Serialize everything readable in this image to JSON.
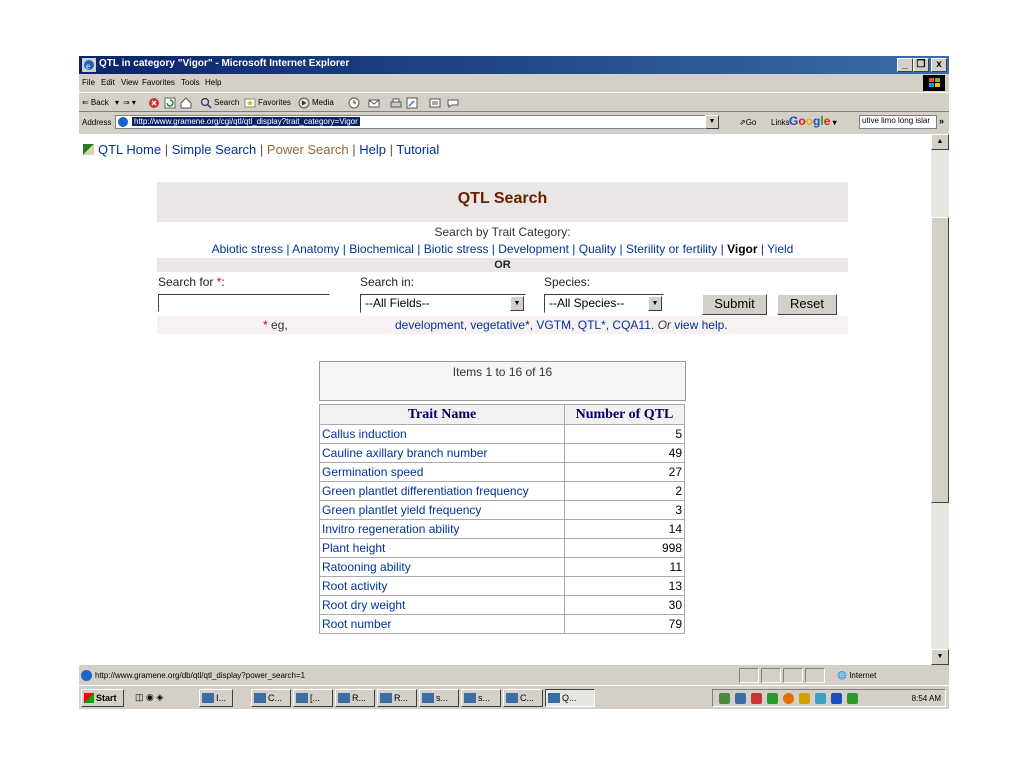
{
  "window": {
    "title": "QTL in category \"Vigor\" - Microsoft Internet Explorer",
    "controls": [
      "_",
      "❐",
      "x"
    ]
  },
  "menu": [
    "File",
    "Edit",
    "View",
    "Favorites",
    "Tools",
    "Help"
  ],
  "toolbar": {
    "back": "⇐ Back",
    "search": "Search",
    "favorites": "Favorites",
    "media": "Media"
  },
  "address": {
    "label": "Address",
    "url": "http://www.gramene.org/cgi/qtl/qtl_display?trait_category=Vigor",
    "go": "Go",
    "links": "Links",
    "google": "Google",
    "search_text": "utive limo long islar"
  },
  "nav": {
    "home": "QTL Home",
    "simple": "Simple Search",
    "power": "Power Search",
    "help": "Help",
    "tutorial": "Tutorial"
  },
  "search": {
    "title": "QTL Search",
    "category_header": "Search by Trait Category:",
    "categories": [
      "Abiotic stress",
      "Anatomy",
      "Biochemical",
      "Biotic stress",
      "Development",
      "Quality",
      "Sterility or fertility",
      "Vigor",
      "Yield"
    ],
    "or": "OR",
    "search_for_label": "Search for",
    "required_mark": "*",
    "search_in_label": "Search in:",
    "species_label": "Species:",
    "fields_select": "--All Fields--",
    "species_select": "--All Species--",
    "submit": "Submit",
    "reset": "Reset",
    "hint_prefix": "eg,",
    "hint_examples": "development,  vegetative*,  VGTM,  QTL*,  CQA11.",
    "hint_or": "Or",
    "hint_view": "view help."
  },
  "results": {
    "summary": "Items 1 to 16 of 16",
    "col_trait": "Trait Name",
    "col_number": "Number of QTL",
    "rows": [
      {
        "name": "Callus induction",
        "count": "5"
      },
      {
        "name": "Cauline axillary branch number",
        "count": "49"
      },
      {
        "name": "Germination speed",
        "count": "27"
      },
      {
        "name": "Green plantlet differentiation frequency",
        "count": "2"
      },
      {
        "name": "Green plantlet yield frequency",
        "count": "3"
      },
      {
        "name": "Invitro regeneration ability",
        "count": "14"
      },
      {
        "name": "Plant height",
        "count": "998"
      },
      {
        "name": "Ratooning ability",
        "count": "11"
      },
      {
        "name": "Root activity",
        "count": "13"
      },
      {
        "name": "Root dry weight",
        "count": "30"
      },
      {
        "name": "Root number",
        "count": "79"
      }
    ]
  },
  "status": {
    "text": "http://www.gramene.org/db/qtl/qtl_display?power_search=1",
    "zone": "Internet"
  },
  "taskbar": {
    "start": "Start",
    "tasks": [
      "I...",
      "C...",
      "[...",
      "R...",
      "R...",
      "s...",
      "s...",
      "C...",
      "Q..."
    ],
    "clock": "8:54 AM"
  }
}
